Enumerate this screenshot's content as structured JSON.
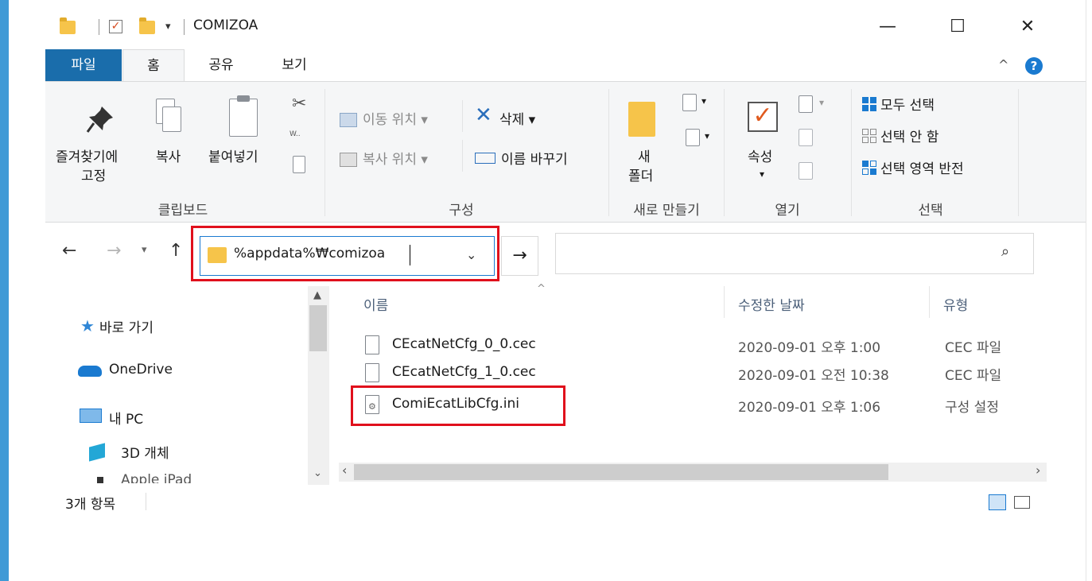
{
  "window": {
    "title": "COMIZOA",
    "minimize": "—",
    "maximize": "☐",
    "close": "✕"
  },
  "tabs": [
    {
      "label": "파일"
    },
    {
      "label": "홈"
    },
    {
      "label": "공유"
    },
    {
      "label": "보기"
    }
  ],
  "ribbon": {
    "clipboard": {
      "pin_line1": "즐겨찾기에",
      "pin_line2": "고정",
      "copy": "복사",
      "paste": "붙여넣기",
      "group": "클립보드"
    },
    "organize": {
      "move_to": "이동 위치",
      "copy_to": "복사 위치",
      "delete": "삭제",
      "rename": "이름 바꾸기",
      "group": "구성"
    },
    "new": {
      "new_folder_line1": "새",
      "new_folder_line2": "폴더",
      "group": "새로 만들기"
    },
    "open": {
      "properties": "속성",
      "group": "열기"
    },
    "select": {
      "select_all": "모두 선택",
      "select_none": "선택 안 함",
      "invert": "선택 영역 반전",
      "group": "선택"
    }
  },
  "address": {
    "value": "%appdata%₩comizoa"
  },
  "search": {
    "placeholder": ""
  },
  "nav_pane": [
    {
      "label": "바로 가기",
      "icon": "star-icon"
    },
    {
      "label": "OneDrive",
      "icon": "cloud-icon"
    },
    {
      "label": "내 PC",
      "icon": "pc-icon"
    },
    {
      "label": "3D 개체",
      "icon": "cube-icon"
    },
    {
      "label": "Apple iPad",
      "icon": "device-icon"
    }
  ],
  "columns": {
    "name": "이름",
    "date": "수정한 날짜",
    "type": "유형"
  },
  "files": [
    {
      "name": "CEcatNetCfg_0_0.cec",
      "date": "2020-09-01 오후 1:00",
      "type": "CEC 파일",
      "icon": "file-icon"
    },
    {
      "name": "CEcatNetCfg_1_0.cec",
      "date": "2020-09-01 오전 10:38",
      "type": "CEC 파일",
      "icon": "file-icon"
    },
    {
      "name": "ComiEcatLibCfg.ini",
      "date": "2020-09-01 오후 1:06",
      "type": "구성 설정",
      "icon": "settings-file-icon"
    }
  ],
  "status": {
    "count": "3개 항목"
  },
  "colors": {
    "accent": "#1a6dab",
    "highlight": "#e0101c",
    "folder": "#f6c44a"
  }
}
